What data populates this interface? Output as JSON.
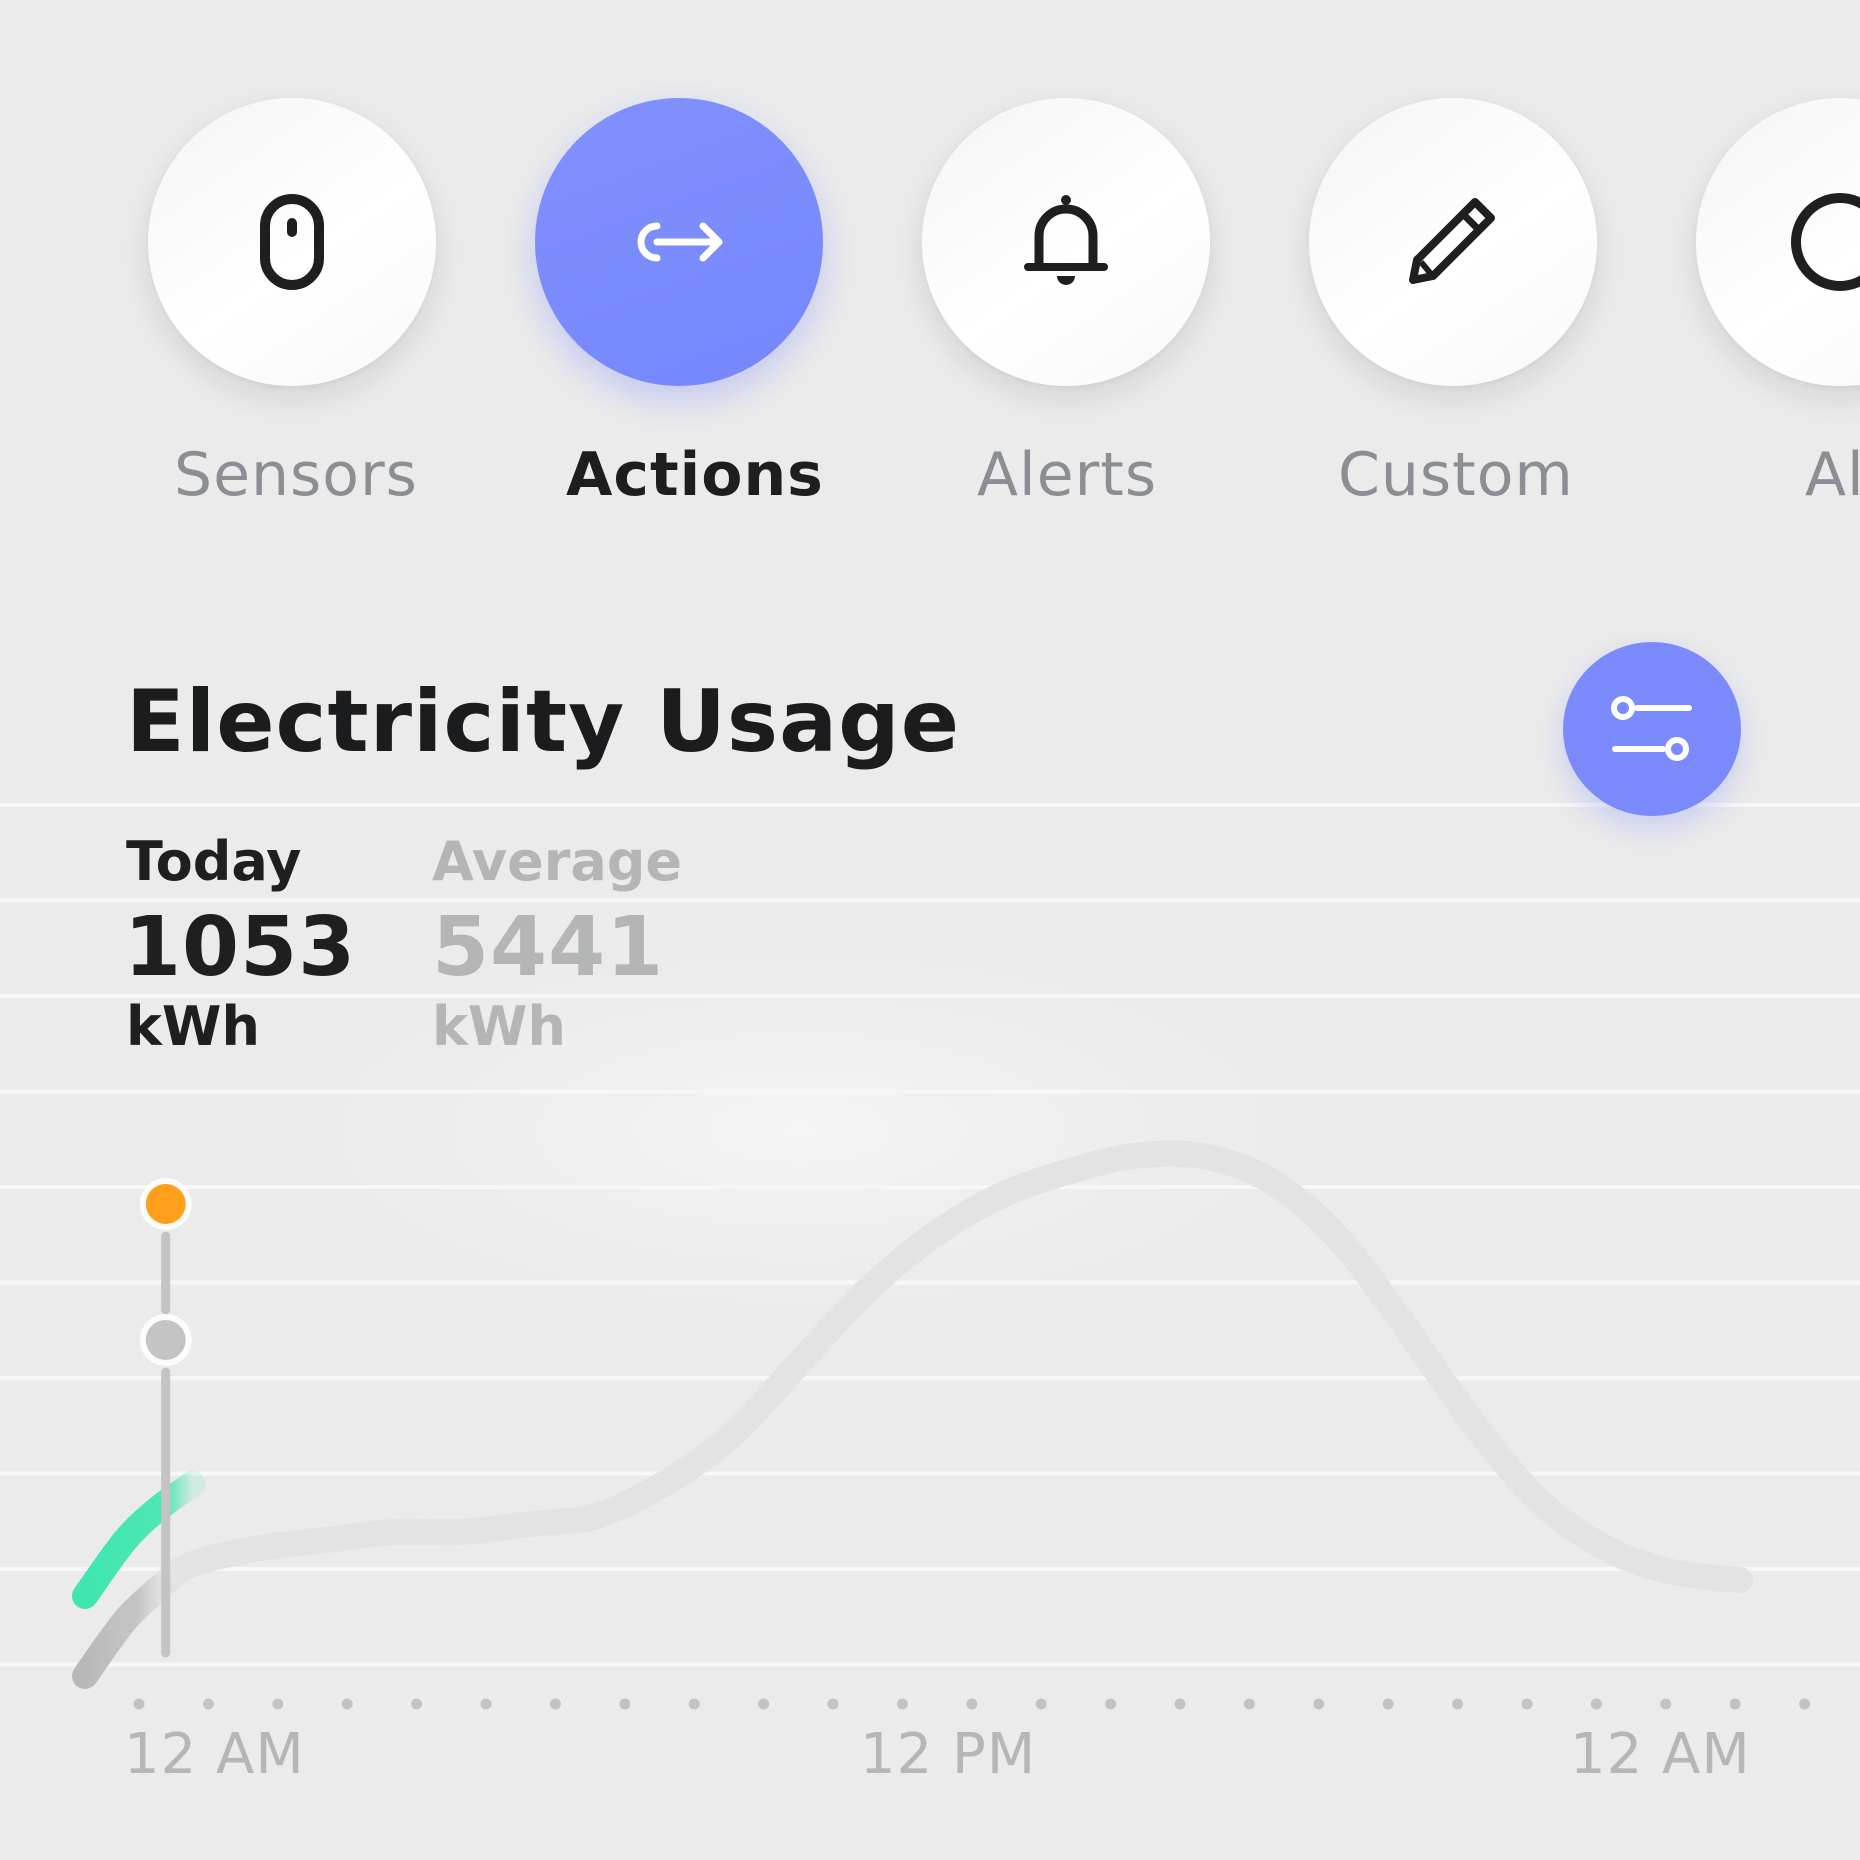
{
  "categories": [
    {
      "label": "Sensors",
      "icon": "sensor-icon",
      "active": false
    },
    {
      "label": "Actions",
      "icon": "action-arrow-icon",
      "active": true
    },
    {
      "label": "Alerts",
      "icon": "bell-icon",
      "active": false
    },
    {
      "label": "Custom",
      "icon": "pencil-icon",
      "active": false
    },
    {
      "label": "Al",
      "icon": "circle-icon",
      "active": false
    }
  ],
  "header": {
    "title": "Electricity Usage",
    "filter_icon": "sliders-icon"
  },
  "stats": {
    "today": {
      "label": "Today",
      "value": "1053",
      "unit": "kWh"
    },
    "average": {
      "label": "Average",
      "value": "5441",
      "unit": "kWh"
    }
  },
  "colors": {
    "accent": "#7b8afc",
    "today_series": "#3ee6b0",
    "average_series": "#bdbdbd",
    "marker_today": "#ff9f1c",
    "marker_average": "#c4c4c4",
    "text_dark": "#1d1e20",
    "text_muted": "#8b8f93"
  },
  "chart_data": {
    "type": "line",
    "x_tick_labels": [
      "12 AM",
      "12 PM",
      "12 AM"
    ],
    "series": [
      {
        "x": [
          0,
          0.5,
          1,
          2,
          3,
          4,
          5,
          6,
          7,
          8,
          9,
          10,
          11,
          12,
          13,
          14,
          15,
          16,
          17,
          18,
          19,
          20,
          21,
          22,
          23,
          24
        ],
        "values": [
          0.05,
          0.09,
          0.12,
          0.14,
          0.15,
          0.16,
          0.16,
          0.17,
          0.18,
          0.22,
          0.28,
          0.37,
          0.46,
          0.53,
          0.58,
          0.61,
          0.63,
          0.63,
          0.6,
          0.53,
          0.42,
          0.3,
          0.2,
          0.14,
          0.11,
          0.1
        ]
      },
      {
        "x": [
          0,
          0.5,
          1
        ],
        "values": [
          0.15,
          0.19,
          0.22
        ]
      }
    ],
    "current_x": 0.6,
    "current_values": [
      0.4,
      0.57
    ],
    "xlim": [
      -0.6,
      24
    ],
    "ylim": [
      0,
      1
    ],
    "grid": true
  }
}
